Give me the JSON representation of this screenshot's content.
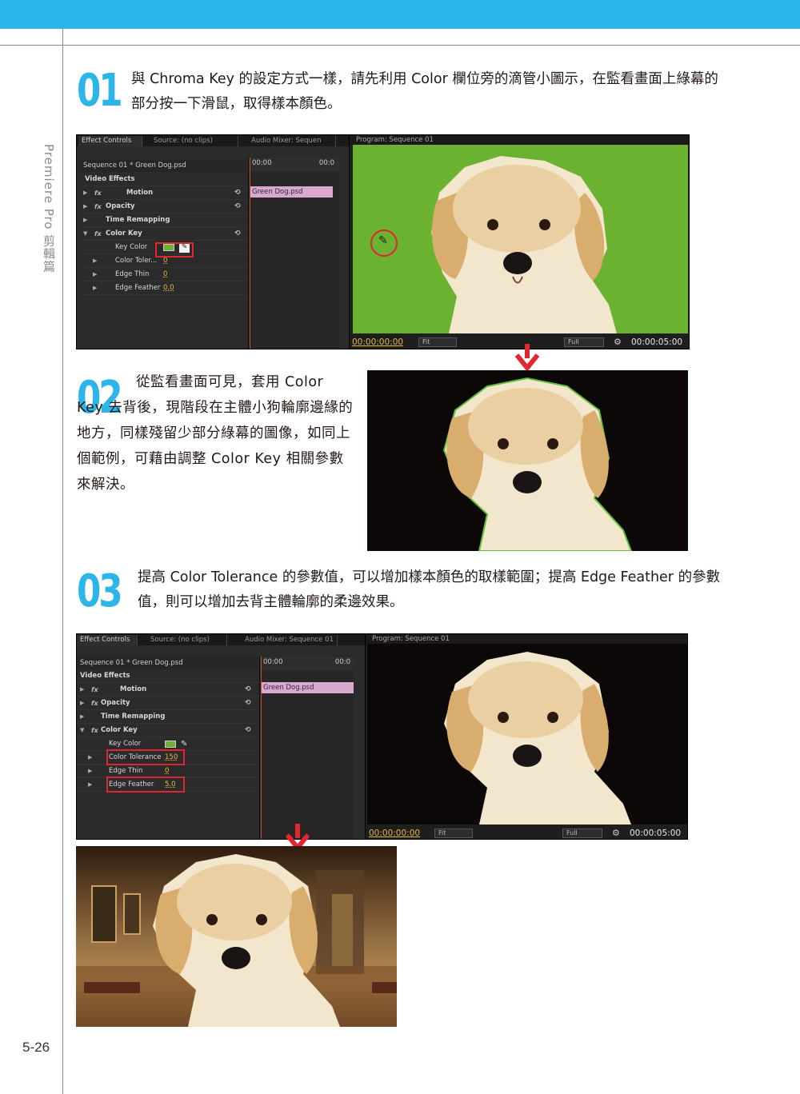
{
  "page": {
    "side_title": "Premiere Pro 剪輯篇",
    "page_number": "5-26",
    "accent_color": "#2cb5e9"
  },
  "steps": [
    {
      "number": "01",
      "text": "與 Chroma Key 的設定方式一樣，請先利用 Color 欄位旁的滴管小圖示，在監看畫面上綠幕的部分按一下滑鼠，取得樣本顏色。"
    },
    {
      "number": "02",
      "text": "從監看畫面可見，套用 Color Key 去背後，現階段在主體小狗輪廓邊緣的地方，同樣殘留少部分綠幕的圖像，如同上個範例，可藉由調整 Color Key 相關參數來解決。"
    },
    {
      "number": "03",
      "text": "提高 Color Tolerance 的參數值，可以增加樣本顏色的取樣範圍；提高 Edge Feather 的參數值，則可以增加去背主體輪廓的柔邊效果。"
    }
  ],
  "ui1": {
    "tabs": [
      "Effect Controls",
      "Source: (no clips)",
      "Audio Mixer: Sequen"
    ],
    "program_tab": "Program: Sequence 01",
    "sequence": "Sequence 01 * Green Dog.psd",
    "timecode_head": "00:00",
    "timecode_head_end": "00:0",
    "clip": "Green Dog.psd",
    "rows": [
      {
        "label": "Video Effects"
      },
      {
        "label": "Motion"
      },
      {
        "label": "Opacity"
      },
      {
        "label": "Time Remapping"
      },
      {
        "label": "Color Key"
      },
      {
        "label": "Key Color"
      },
      {
        "label": "Color Toler...",
        "value": "0"
      },
      {
        "label": "Edge Thin",
        "value": "0"
      },
      {
        "label": "Edge Feather",
        "value": "0.0"
      }
    ],
    "timecode": "00:00:00:00",
    "fit": "Fit",
    "full": "Full",
    "duration": "00:00:05:00"
  },
  "ui2": {
    "tabs": [
      "Effect Controls",
      "Source: (no clips)",
      "Audio Mixer: Sequence 01"
    ],
    "program_tab": "Program: Sequence 01",
    "sequence": "Sequence 01 * Green Dog.psd",
    "timecode_head": "00:00",
    "timecode_head_end": "00:0",
    "clip": "Green Dog.psd",
    "rows": [
      {
        "label": "Video Effects"
      },
      {
        "label": "Motion"
      },
      {
        "label": "Opacity"
      },
      {
        "label": "Time Remapping"
      },
      {
        "label": "Color Key"
      },
      {
        "label": "Key Color"
      },
      {
        "label": "Color Tolerance",
        "value": "150"
      },
      {
        "label": "Edge Thin",
        "value": "0"
      },
      {
        "label": "Edge Feather",
        "value": "5.0"
      }
    ],
    "timecode": "00:00:00:00",
    "fit": "Fit",
    "full": "Full",
    "duration": "00:00:05:00"
  }
}
